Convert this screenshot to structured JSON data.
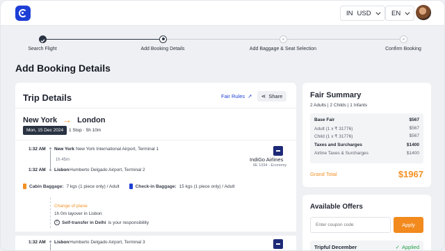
{
  "header": {
    "country": "IN",
    "currency": "USD",
    "language": "EN"
  },
  "stepper": {
    "steps": [
      {
        "label": "Search Flight",
        "state": "done"
      },
      {
        "label": "Add Booking Details",
        "state": "current"
      },
      {
        "label": "Add Baggage & Seat Selection",
        "state": "todo"
      },
      {
        "label": "Confirm Booking",
        "state": "todo"
      }
    ]
  },
  "page": {
    "title": "Add Booking Details"
  },
  "trip": {
    "title": "Trip Details",
    "fair_rules": "Fair Rules",
    "share": "Share",
    "from": "New York",
    "to": "London",
    "date": "Mon, 15 Dec 2024",
    "stops": "1 Stop",
    "total_duration": "5h 10m",
    "segment1": {
      "dep_time": "1:32 AM",
      "dep_city": "New York",
      "dep_airport": "New York International Airport, Terminal 1",
      "duration": "1h 45m",
      "arr_time": "1:32 AM",
      "arr_city": "Lisbon",
      "arr_airport": "Humberto Delgado Airport, Terminal 2",
      "airline": "IndiGo Airlines",
      "flight_info": "6E 1034 - Economy"
    },
    "cabin_label": "Cabin Baggage:",
    "cabin_value": "7 kgs (1 piece only) / Adult",
    "checkin_label": "Check-in Baggage:",
    "checkin_value": "15 kgs (1 piece only) / Adult",
    "layover": {
      "title": "Change of plane",
      "text": "1h 0m layover in Lisbon",
      "self_transfer_bold": "Self-transfer in Delhi",
      "self_transfer_rest": "is your responsibility"
    },
    "segment2": {
      "dep_time": "1:32 AM",
      "dep_city": "Lisbon",
      "dep_airport": "Humberto Delgado Airport, Terminal 3"
    }
  },
  "fair": {
    "title": "Fair Summary",
    "pax": "2 Adults | 2 Childs | 1 Infants",
    "base_label": "Base Fair",
    "base_value": "$567",
    "adult_label": "Adult (1 x ₹ 31776)",
    "adult_value": "$567",
    "child_label": "Child (1 x ₹ 31776)",
    "child_value": "$567",
    "tax_label": "Taxes and Surcharges",
    "tax_value": "$1400",
    "airline_tax_label": "Airline Taxes & Surcharges",
    "airline_tax_value": "$1400",
    "grand_label": "Grand Total",
    "grand_value": "$1967"
  },
  "offers": {
    "title": "Available Offers",
    "placeholder": "Enter coupon code",
    "apply": "Apply",
    "offer_name": "Tripful December",
    "offer_status": "Applied"
  },
  "colors": {
    "accent": "#f29124",
    "brand": "#1e3fd6",
    "success": "#22a04b"
  }
}
